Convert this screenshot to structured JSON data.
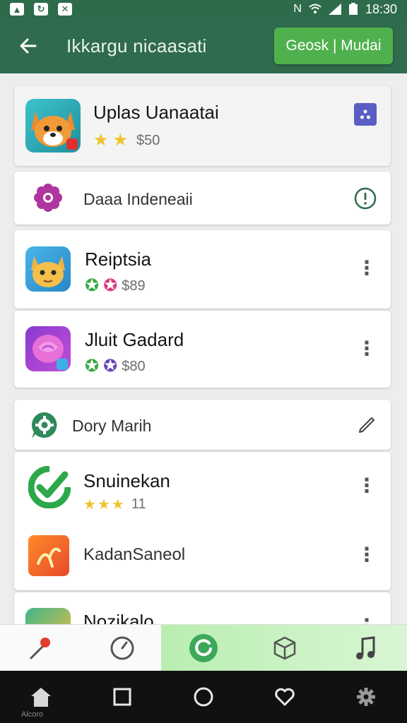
{
  "status_bar": {
    "time": "18:30",
    "icons": [
      "notification-icon",
      "sync-icon",
      "tools-icon",
      "mute-icon",
      "wifi-icon",
      "signal-icon",
      "battery-icon"
    ]
  },
  "app_bar": {
    "title": "Ikkargu nicaasati",
    "action_label": "Geosk | Mudai",
    "back_icon": "arrow-left-icon"
  },
  "featured": {
    "title": "Uplas Uanaatai",
    "price": "$50",
    "rating_stars": 2
  },
  "section_1": {
    "label": "Daaa Indeneaii"
  },
  "apps_1": [
    {
      "title": "Reiptsia",
      "price": "$89"
    },
    {
      "title": "Jluit Gadard",
      "price": "$80"
    }
  ],
  "section_2": {
    "label": "Dory Marih"
  },
  "apps_2": [
    {
      "title": "Snuinekan",
      "rating_count": "11",
      "rating_stars": 3
    },
    {
      "title": "KadanSaneol"
    },
    {
      "title": "Nozikalo"
    }
  ],
  "system_nav": {
    "caption": "Alcoro"
  },
  "colors": {
    "app_bar": "#2f6b4c",
    "accent_button": "#4fb14e",
    "star": "#f3c12a",
    "active_tab": "#c6f0bf"
  }
}
